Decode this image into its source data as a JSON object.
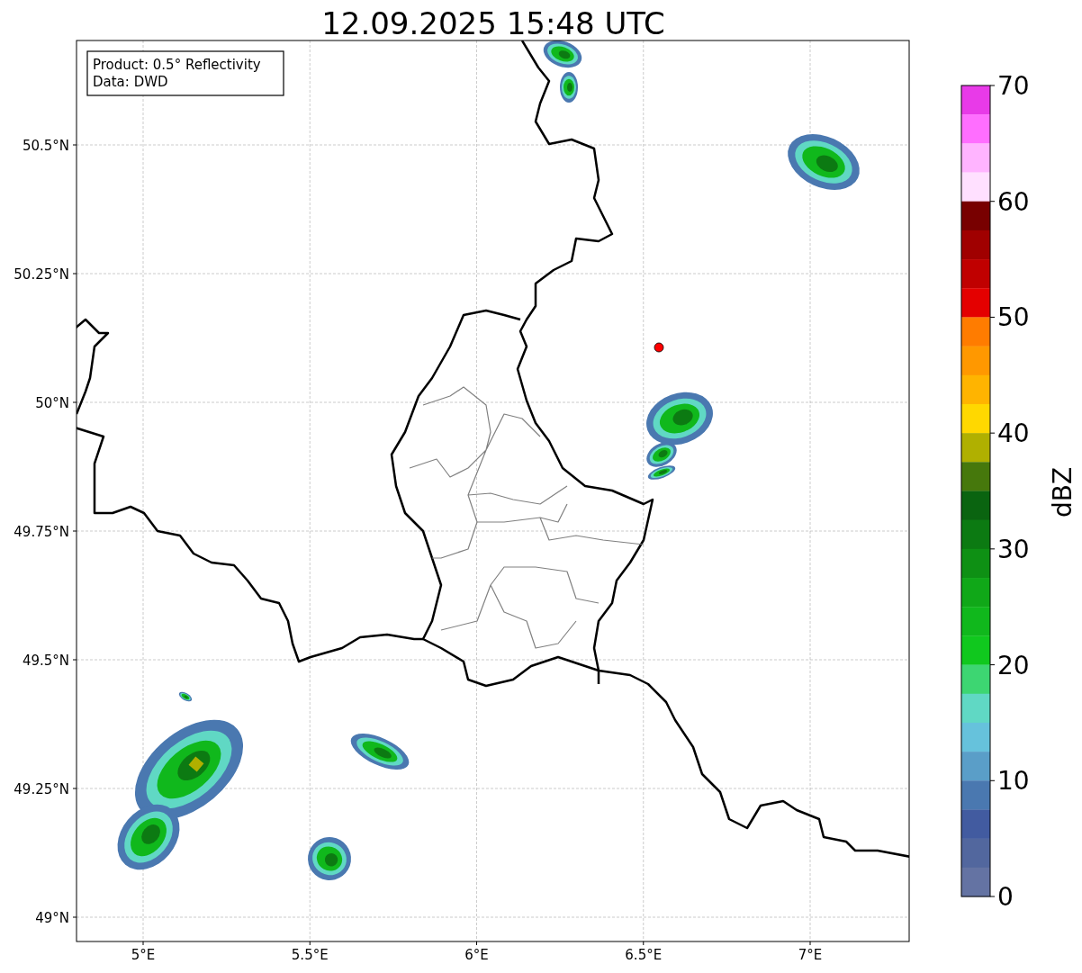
{
  "title": "12.09.2025 15:48 UTC",
  "info_box": [
    "Product: 0.5° Reflectivity",
    "Data: DWD"
  ],
  "map": {
    "y_tick_labels": [
      "50.5°N",
      "50.25°N",
      "50°N",
      "49.75°N",
      "49.5°N",
      "49.25°N",
      "49°N"
    ],
    "x_tick_labels": [
      "5°E",
      "5.5°E",
      "6°E",
      "6.5°E",
      "7°E"
    ]
  },
  "colorbar": {
    "label": "dBZ",
    "tick_labels": [
      "70",
      "60",
      "50",
      "40",
      "30",
      "20",
      "10",
      "0"
    ],
    "segments": [
      {
        "color": "#e83ae8"
      },
      {
        "color": "#ff6eff"
      },
      {
        "color": "#ffb4ff"
      },
      {
        "color": "#ffe0ff"
      },
      {
        "color": "#780000"
      },
      {
        "color": "#a00000"
      },
      {
        "color": "#c00000"
      },
      {
        "color": "#e40000"
      },
      {
        "color": "#ff7c00"
      },
      {
        "color": "#ff9800"
      },
      {
        "color": "#ffb400"
      },
      {
        "color": "#ffd800"
      },
      {
        "color": "#b0b000"
      },
      {
        "color": "#46780c"
      },
      {
        "color": "#0a6410"
      },
      {
        "color": "#0c7a12"
      },
      {
        "color": "#0e9014"
      },
      {
        "color": "#10a818"
      },
      {
        "color": "#10b81c"
      },
      {
        "color": "#10c81e"
      },
      {
        "color": "#3dd672"
      },
      {
        "color": "#60d8c4"
      },
      {
        "color": "#66c2dc"
      },
      {
        "color": "#5a9ec8"
      },
      {
        "color": "#4a78b0"
      },
      {
        "color": "#425ba0"
      },
      {
        "color": "#52679e"
      },
      {
        "color": "#6473a3"
      }
    ]
  }
}
